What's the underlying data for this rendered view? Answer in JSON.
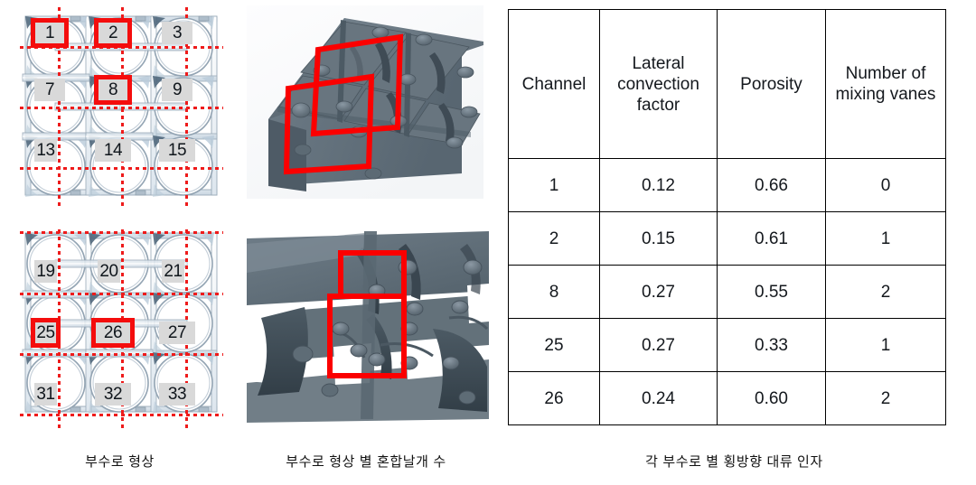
{
  "figure": {
    "panels": [
      {
        "id": "geometry",
        "caption": "부수로 형상"
      },
      {
        "id": "vanes",
        "caption": "부수로 형상 별 혼합날개 수"
      },
      {
        "id": "table",
        "caption": "각 부수로 별 횡방향 대류 인자"
      }
    ]
  },
  "colors": {
    "highlight_red": "#f40d0d",
    "dotted_grid_red": "#ee1b1b",
    "chip_gray": "#d9d9d9",
    "cad_body": "#64727d",
    "cad_shadow": "#3f4a53",
    "table_border": "#000000",
    "background": "#ffffff"
  },
  "geometry_panel": {
    "title": "부수로 형상",
    "diagrams": [
      {
        "id": "subchannel-map-top",
        "rows": [
          [
            {
              "label": "1",
              "highlighted": true,
              "wrap": false
            },
            {
              "label": "2",
              "highlighted": true,
              "wrap": false
            },
            {
              "label": "3",
              "highlighted": false,
              "wrap": false
            }
          ],
          [
            {
              "label": "7",
              "highlighted": false,
              "wrap": false
            },
            {
              "label": "8",
              "highlighted": true,
              "wrap": false
            },
            {
              "label": "9",
              "highlighted": false,
              "wrap": false
            }
          ],
          [
            {
              "label": "13",
              "highlighted": false,
              "wrap": true
            },
            {
              "label": "14",
              "highlighted": false,
              "wrap": false
            },
            {
              "label": "15",
              "highlighted": false,
              "wrap": false
            }
          ]
        ]
      },
      {
        "id": "subchannel-map-bottom",
        "rows": [
          [
            {
              "label": "19",
              "highlighted": false,
              "wrap": true
            },
            {
              "label": "20",
              "highlighted": false,
              "wrap": true
            },
            {
              "label": "21",
              "highlighted": false,
              "wrap": true
            }
          ],
          [
            {
              "label": "25",
              "highlighted": true,
              "wrap": true
            },
            {
              "label": "26",
              "highlighted": true,
              "wrap": false
            },
            {
              "label": "27",
              "highlighted": false,
              "wrap": false
            }
          ],
          [
            {
              "label": "31",
              "highlighted": false,
              "wrap": true
            },
            {
              "label": "32",
              "highlighted": false,
              "wrap": false
            },
            {
              "label": "33",
              "highlighted": false,
              "wrap": false
            }
          ]
        ]
      }
    ]
  },
  "vanes_panel": {
    "title": "부수로 형상 별 혼합날개 수",
    "images": [
      {
        "id": "cad-view-top",
        "description": "spacer grid corner 3D view with two red annotation boxes"
      },
      {
        "id": "cad-view-bottom",
        "description": "spacer grid mixing vane close-up with two red annotation boxes"
      }
    ]
  },
  "table_panel": {
    "title": "각 부수로 별 횡방향 대류 인자",
    "columns": [
      {
        "key": "channel",
        "header": "Channel"
      },
      {
        "key": "lcf",
        "header": "Lateral convection factor"
      },
      {
        "key": "por",
        "header": "Porosity"
      },
      {
        "key": "vanes",
        "header": "Number of mixing vanes"
      }
    ],
    "rows": [
      {
        "channel": "1",
        "lcf": "0.12",
        "por": "0.66",
        "vanes": "0"
      },
      {
        "channel": "2",
        "lcf": "0.15",
        "por": "0.61",
        "vanes": "1"
      },
      {
        "channel": "8",
        "lcf": "0.27",
        "por": "0.55",
        "vanes": "2"
      },
      {
        "channel": "25",
        "lcf": "0.27",
        "por": "0.33",
        "vanes": "1"
      },
      {
        "channel": "26",
        "lcf": "0.24",
        "por": "0.60",
        "vanes": "2"
      }
    ]
  },
  "chart_data": {
    "type": "table",
    "title": "각 부수로 별 횡방향 대류 인자",
    "columns": [
      "Channel",
      "Lateral convection factor",
      "Porosity",
      "Number of mixing vanes"
    ],
    "rows": [
      [
        "1",
        0.12,
        0.66,
        0
      ],
      [
        "2",
        0.15,
        0.61,
        1
      ],
      [
        "8",
        0.27,
        0.55,
        2
      ],
      [
        "25",
        0.27,
        0.33,
        1
      ],
      [
        "26",
        0.24,
        0.6,
        2
      ]
    ],
    "series": [
      {
        "name": "Lateral convection factor",
        "values": [
          0.12,
          0.15,
          0.27,
          0.27,
          0.24
        ]
      },
      {
        "name": "Porosity",
        "values": [
          0.66,
          0.61,
          0.55,
          0.33,
          0.6
        ]
      },
      {
        "name": "Number of mixing vanes",
        "values": [
          0,
          1,
          2,
          1,
          2
        ]
      }
    ],
    "categories": [
      "1",
      "2",
      "8",
      "25",
      "26"
    ],
    "xlabel": "Channel",
    "ylabel": "",
    "grid": true,
    "legend": "none"
  }
}
